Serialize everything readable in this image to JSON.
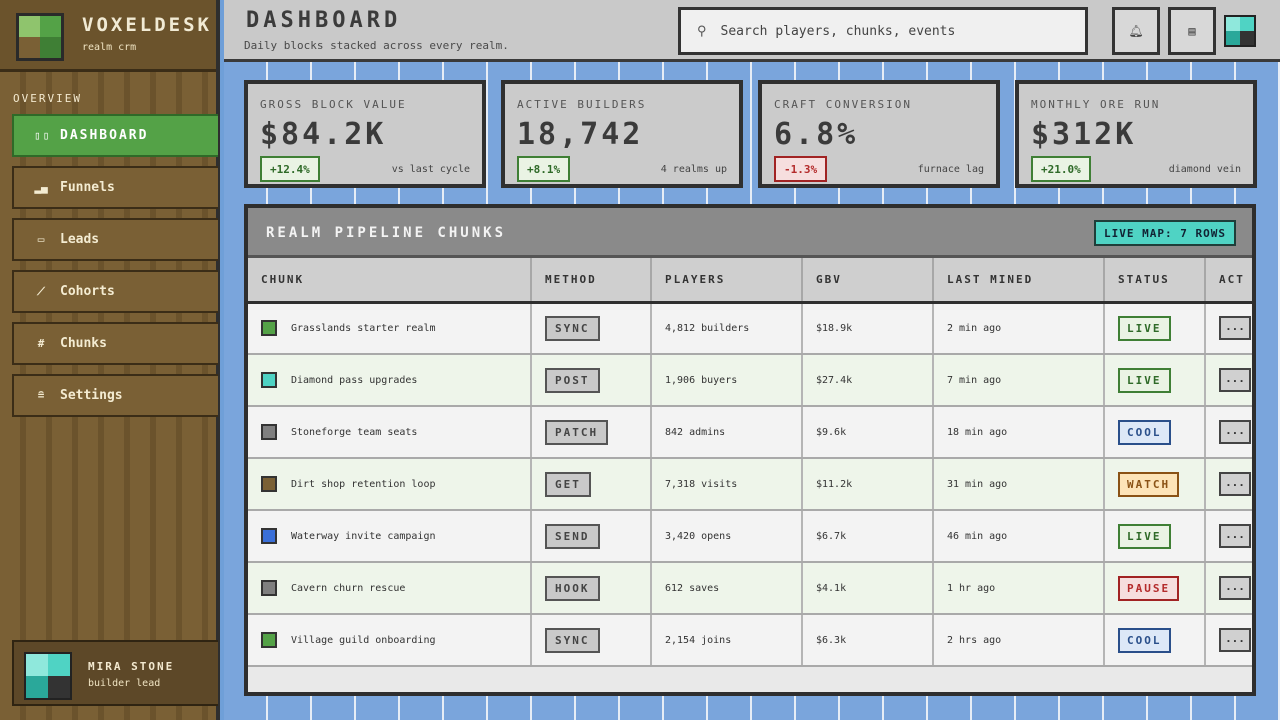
{
  "brand": {
    "name": "VOXELDESK",
    "sub": "realm crm"
  },
  "nav": {
    "section_label": "OVERVIEW",
    "items": [
      {
        "label": "DASHBOARD",
        "icon": "grid-icon"
      },
      {
        "label": "Funnels",
        "icon": "bars-icon"
      },
      {
        "label": "Leads",
        "icon": "card-icon"
      },
      {
        "label": "Cohorts",
        "icon": "trend-icon"
      },
      {
        "label": "Chunks",
        "icon": "hash-icon"
      },
      {
        "label": "Settings",
        "icon": "stack-icon"
      }
    ]
  },
  "user": {
    "name": "MIRA STONE",
    "role": "builder lead"
  },
  "header": {
    "title": "DASHBOARD",
    "subtitle": "Daily blocks stacked across every realm.",
    "search_placeholder": "Search players, chunks, events"
  },
  "kpis": [
    {
      "label": "GROSS BLOCK VALUE",
      "value": "$84.2K",
      "delta": "+12.4%",
      "trend": "up",
      "note": "vs last cycle"
    },
    {
      "label": "ACTIVE BUILDERS",
      "value": "18,742",
      "delta": "+8.1%",
      "trend": "up",
      "note": "4 realms up"
    },
    {
      "label": "CRAFT CONVERSION",
      "value": "6.8%",
      "delta": "-1.3%",
      "trend": "down",
      "note": "furnace lag"
    },
    {
      "label": "MONTHLY ORE RUN",
      "value": "$312K",
      "delta": "+21.0%",
      "trend": "up",
      "note": "diamond vein"
    }
  ],
  "table": {
    "title": "REALM PIPELINE CHUNKS",
    "badge": "LIVE MAP: 7 ROWS",
    "columns": [
      "CHUNK",
      "METHOD",
      "PLAYERS",
      "GBV",
      "LAST MINED",
      "STATUS",
      "ACT"
    ],
    "rows": [
      {
        "color": "#54a247",
        "chunk": "Grasslands starter realm",
        "method": "SYNC",
        "players": "4,812 builders",
        "gbv": "$18.9k",
        "last": "2 min ago",
        "status": "LIVE",
        "kind": "live"
      },
      {
        "color": "#4fd3c4",
        "chunk": "Diamond pass upgrades",
        "method": "POST",
        "players": "1,906 buyers",
        "gbv": "$27.4k",
        "last": "7 min ago",
        "status": "LIVE",
        "kind": "live"
      },
      {
        "color": "#7f7f7f",
        "chunk": "Stoneforge team seats",
        "method": "PATCH",
        "players": "842 admins",
        "gbv": "$9.6k",
        "last": "18 min ago",
        "status": "COOL",
        "kind": "cool"
      },
      {
        "color": "#7a6035",
        "chunk": "Dirt shop retention loop",
        "method": "GET",
        "players": "7,318 visits",
        "gbv": "$11.2k",
        "last": "31 min ago",
        "status": "WATCH",
        "kind": "watch"
      },
      {
        "color": "#3a6fd8",
        "chunk": "Waterway invite campaign",
        "method": "SEND",
        "players": "3,420 opens",
        "gbv": "$6.7k",
        "last": "46 min ago",
        "status": "LIVE",
        "kind": "live"
      },
      {
        "color": "#7f7f7f",
        "chunk": "Cavern churn rescue",
        "method": "HOOK",
        "players": "612 saves",
        "gbv": "$4.1k",
        "last": "1 hr ago",
        "status": "PAUSE",
        "kind": "pause"
      },
      {
        "color": "#54a247",
        "chunk": "Village guild onboarding",
        "method": "SYNC",
        "players": "2,154 joins",
        "gbv": "$6.3k",
        "last": "2 hrs ago",
        "status": "COOL",
        "kind": "cool"
      }
    ],
    "action_label": "..."
  }
}
